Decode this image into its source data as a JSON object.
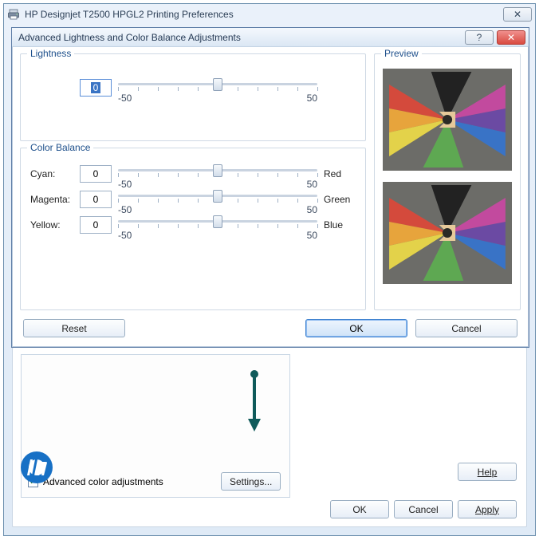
{
  "outer": {
    "title": "HP Designjet T2500 HPGL2 Printing Preferences",
    "close_glyph": "✕",
    "checkbox_label": "Advanced color adjustments",
    "checkbox_checked": true,
    "settings_label": "Settings...",
    "help_label": "Help",
    "ok_label": "OK",
    "cancel_label": "Cancel",
    "apply_label": "Apply"
  },
  "inner": {
    "title": "Advanced Lightness and Color Balance Adjustments",
    "help_glyph": "?",
    "close_glyph": "✕",
    "lightness": {
      "legend": "Lightness",
      "value": "0",
      "min_label": "-50",
      "max_label": "50"
    },
    "colorbalance": {
      "legend": "Color Balance",
      "rows": [
        {
          "left": "Cyan:",
          "value": "0",
          "right": "Red",
          "min_label": "-50",
          "max_label": "50"
        },
        {
          "left": "Magenta:",
          "value": "0",
          "right": "Green",
          "min_label": "-50",
          "max_label": "50"
        },
        {
          "left": "Yellow:",
          "value": "0",
          "right": "Blue",
          "min_label": "-50",
          "max_label": "50"
        }
      ]
    },
    "preview_legend": "Preview",
    "reset_label": "Reset",
    "ok_label": "OK",
    "cancel_label": "Cancel"
  }
}
